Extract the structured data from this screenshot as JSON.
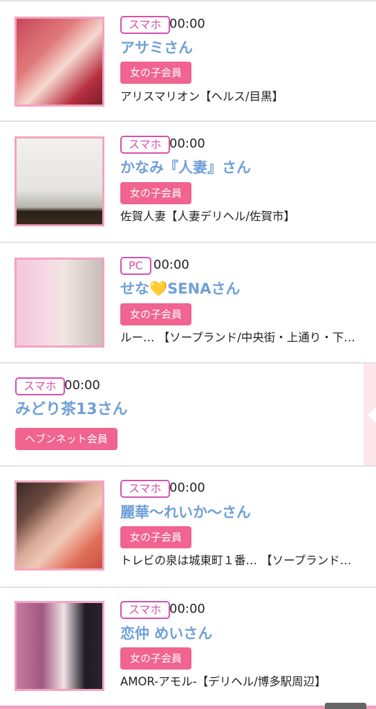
{
  "items": [
    {
      "device": "スマホ",
      "time": "00:00",
      "name": "アサミさん",
      "badge": "女の子会員",
      "shop": "アリスマリオン【ヘルス/目黒】",
      "thumb": "photo-asami"
    },
    {
      "device": "スマホ",
      "time": "00:00",
      "name": "かなみ『人妻』さん",
      "badge": "女の子会員",
      "shop": "佐賀人妻【人妻デリヘル/佐賀市】",
      "thumb": "photo-kanami"
    },
    {
      "device": "PC",
      "time": "00:00",
      "name_prefix": "せな",
      "name_heart": "💛",
      "name_suffix": "SENAさん",
      "badge": "女の子会員",
      "shop": "ルー… 【ソープランド/中央街・上通り・下…",
      "thumb": "photo-sena"
    },
    {
      "device": "スマホ",
      "time": "00:00",
      "name": "みどり茶13さん",
      "badge": "ヘブンネット会員"
    },
    {
      "device": "スマホ",
      "time": "00:00",
      "name": "麗華〜れいか〜さん",
      "badge": "女の子会員",
      "shop": "トレビの泉は城東町１番… 【ソープランド…",
      "thumb": "photo-reika"
    },
    {
      "device": "スマホ",
      "time": "00:00",
      "name": "恋仲 めいさん",
      "badge": "女の子会員",
      "shop": "AMOR-アモル-【デリヘル/博多駅周辺】",
      "thumb": "photo-mei"
    }
  ],
  "colors": {
    "accent_pink": "#f0648f",
    "name_blue": "#6f9fd8",
    "device_magenta": "#d54fb0",
    "thumb_border": "#f4a3c0"
  }
}
